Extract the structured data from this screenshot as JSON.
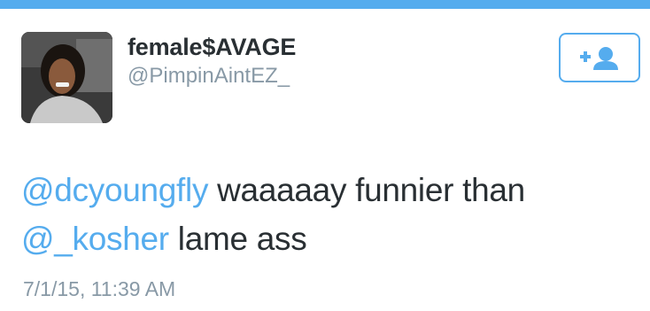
{
  "colors": {
    "accent": "#55acee",
    "text": "#292f33",
    "muted": "#8899a6"
  },
  "author": {
    "display_name": "female$AVAGE",
    "handle": "@PimpinAintEZ_",
    "avatar_icon": "profile-photo"
  },
  "follow_button": {
    "icon": "follow-user-icon"
  },
  "tweet": {
    "mention_1": "@dcyoungfly",
    "text_1": " waaaaay funnier than ",
    "mention_2": "@_kosher",
    "text_2": " lame ass",
    "timestamp": "7/1/15, 11:39 AM"
  }
}
